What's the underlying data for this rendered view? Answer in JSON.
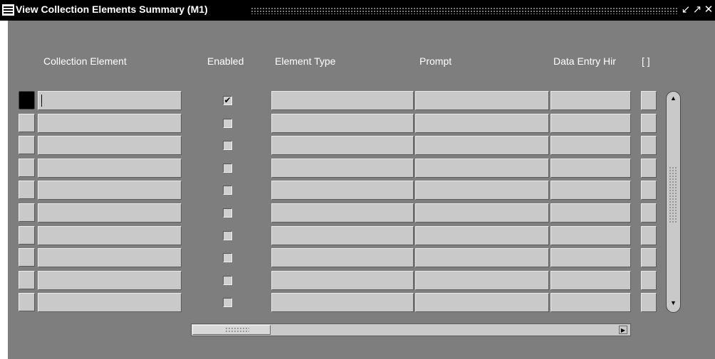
{
  "window": {
    "title": "View Collection Elements Summary (M1)",
    "controls": [
      "minimize-icon",
      "maximize-icon",
      "close-icon"
    ]
  },
  "table": {
    "columns": {
      "collection_element": "Collection Element",
      "enabled": "Enabled",
      "element_type": "Element Type",
      "prompt": "Prompt",
      "data_entry_hint": "Data Entry Hir",
      "desc_flex": "[ ]"
    },
    "rows": [
      {
        "collection_element": "",
        "enabled": true,
        "element_type": "",
        "prompt": "",
        "data_entry_hint": ""
      },
      {
        "collection_element": "",
        "enabled": false,
        "element_type": "",
        "prompt": "",
        "data_entry_hint": ""
      },
      {
        "collection_element": "",
        "enabled": false,
        "element_type": "",
        "prompt": "",
        "data_entry_hint": ""
      },
      {
        "collection_element": "",
        "enabled": false,
        "element_type": "",
        "prompt": "",
        "data_entry_hint": ""
      },
      {
        "collection_element": "",
        "enabled": false,
        "element_type": "",
        "prompt": "",
        "data_entry_hint": ""
      },
      {
        "collection_element": "",
        "enabled": false,
        "element_type": "",
        "prompt": "",
        "data_entry_hint": ""
      },
      {
        "collection_element": "",
        "enabled": false,
        "element_type": "",
        "prompt": "",
        "data_entry_hint": ""
      },
      {
        "collection_element": "",
        "enabled": false,
        "element_type": "",
        "prompt": "",
        "data_entry_hint": ""
      },
      {
        "collection_element": "",
        "enabled": false,
        "element_type": "",
        "prompt": "",
        "data_entry_hint": ""
      },
      {
        "collection_element": "",
        "enabled": false,
        "element_type": "",
        "prompt": "",
        "data_entry_hint": ""
      }
    ],
    "current_row": 1
  },
  "colors": {
    "canvas": "#7e7e7e",
    "field": "#c9c9c9",
    "titlebar": "#000000",
    "header_text": "#ffffff"
  }
}
